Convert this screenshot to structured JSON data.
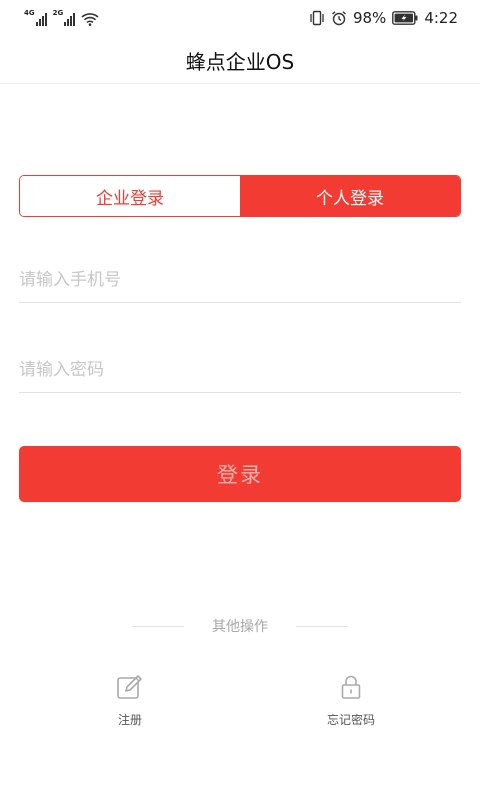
{
  "status_bar": {
    "network1": "4G",
    "network2": "2G",
    "battery_percent": "98%",
    "time": "4:22"
  },
  "header": {
    "title": "蜂点企业OS"
  },
  "tabs": {
    "enterprise": "企业登录",
    "personal": "个人登录",
    "active": "personal"
  },
  "form": {
    "phone_placeholder": "请输入手机号",
    "phone_value": "",
    "password_placeholder": "请输入密码",
    "password_value": "",
    "login_label": "登录"
  },
  "other": {
    "title": "其他操作",
    "register_label": "注册",
    "forgot_label": "忘记密码"
  },
  "colors": {
    "accent": "#f23b33",
    "placeholder": "#c7c7c7",
    "divider": "#e2e2e2"
  },
  "icons": {
    "register": "edit-icon",
    "forgot": "lock-icon"
  }
}
